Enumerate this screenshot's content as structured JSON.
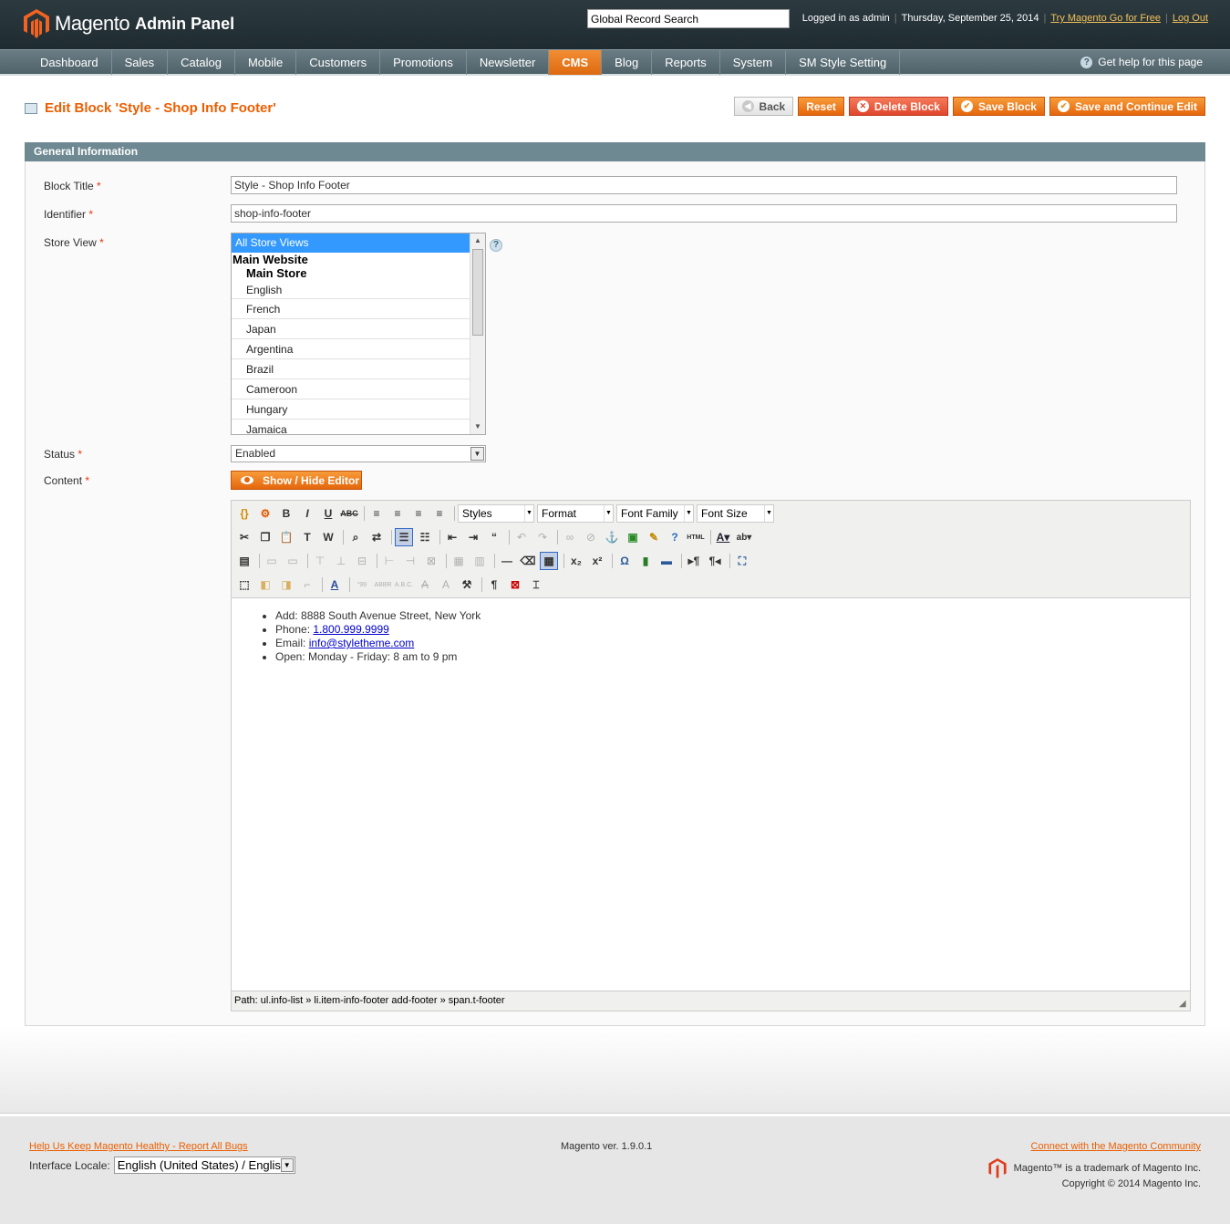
{
  "header": {
    "brand": "Magento",
    "brand_sub": "Admin Panel",
    "search_value": "Global Record Search",
    "logged_in": "Logged in as admin",
    "date": "Thursday, September 25, 2014",
    "try_link": "Try Magento Go for Free",
    "logout": "Log Out"
  },
  "nav": {
    "items": [
      "Dashboard",
      "Sales",
      "Catalog",
      "Mobile",
      "Customers",
      "Promotions",
      "Newsletter",
      "CMS",
      "Blog",
      "Reports",
      "System",
      "SM Style Setting"
    ],
    "active": "CMS",
    "help": "Get help for this page"
  },
  "page": {
    "title": "Edit Block 'Style - Shop Info Footer'",
    "buttons": {
      "back": "Back",
      "reset": "Reset",
      "delete": "Delete Block",
      "save": "Save Block",
      "save_continue": "Save and Continue Edit"
    }
  },
  "form": {
    "section": "General Information",
    "block_title_label": "Block Title",
    "block_title_value": "Style - Shop Info Footer",
    "identifier_label": "Identifier",
    "identifier_value": "shop-info-footer",
    "store_view_label": "Store View",
    "store_options": {
      "selected": "All Store Views",
      "website": "Main Website",
      "store": "Main Store",
      "views": [
        "English",
        "French",
        "Japan",
        "Argentina",
        "Brazil",
        "Cameroon",
        "Hungary",
        "Jamaica"
      ]
    },
    "status_label": "Status",
    "status_value": "Enabled",
    "content_label": "Content",
    "editor_button": "Show / Hide Editor"
  },
  "editor": {
    "selects": {
      "styles": "Styles",
      "format": "Format",
      "font_family": "Font Family",
      "font_size": "Font Size"
    },
    "content": {
      "address": "Add: 8888 South Avenue Street, New York",
      "phone_label": "Phone: ",
      "phone": "1.800.999.9999",
      "email_label": "Email: ",
      "email": "info@styletheme.com",
      "open": "Open: Monday - Friday: 8 am to 9 pm"
    },
    "path": "Path: ul.info-list » li.item-info-footer add-footer » span.t-footer"
  },
  "footer": {
    "report": "Help Us Keep Magento Healthy - Report All Bugs",
    "locale_label": "Interface Locale:",
    "locale_value": "English (United States) / English",
    "version": "Magento ver. 1.9.0.1",
    "connect": "Connect with the Magento Community",
    "trademark": "Magento™ is a trademark of Magento Inc.",
    "copyright": "Copyright © 2014 Magento Inc."
  },
  "colors": {
    "accent": "#eb5e00",
    "header_bg": "#26343a",
    "nav_bg": "#5d7077",
    "section_bg": "#6f8992"
  }
}
